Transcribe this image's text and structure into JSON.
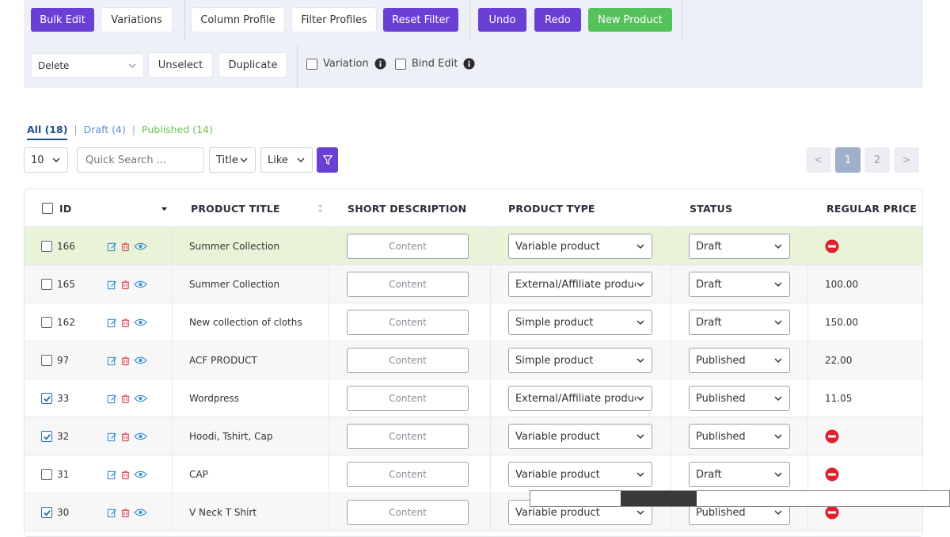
{
  "toolbar": {
    "bulk_edit": "Bulk Edit",
    "variations": "Variations",
    "column_profile": "Column Profile",
    "filter_profiles": "Filter Profiles",
    "reset_filter": "Reset Filter",
    "undo": "Undo",
    "redo": "Redo",
    "new_product": "New Product",
    "bulk_action": "Delete",
    "unselect": "Unselect",
    "duplicate": "Duplicate",
    "variation_label": "Variation",
    "bind_edit_label": "Bind Edit"
  },
  "tabs": {
    "all": "All (18)",
    "draft": "Draft (4)",
    "published": "Published (14)",
    "separator": "|"
  },
  "filters": {
    "per_page": "10",
    "search_placeholder": "Quick Search ...",
    "field": "Title",
    "operator": "Like"
  },
  "pagination": {
    "prev": "<",
    "pages": [
      "1",
      "2"
    ],
    "current": "1",
    "next": ">"
  },
  "table": {
    "columns": {
      "id": "ID",
      "product_title": "PRODUCT TITLE",
      "short_description": "SHORT DESCRIPTION",
      "product_type": "PRODUCT TYPE",
      "status": "STATUS",
      "regular_price": "REGULAR PRICE"
    },
    "content_label": "Content",
    "rows": [
      {
        "id": "166",
        "title": "Summer Collection",
        "type": "Variable product",
        "status": "Draft",
        "price": "",
        "checked": false,
        "price_missing": true
      },
      {
        "id": "165",
        "title": "Summer Collection",
        "type": "External/Affiliate product",
        "status": "Draft",
        "price": "100.00",
        "checked": false,
        "price_missing": false
      },
      {
        "id": "162",
        "title": "New collection of cloths",
        "type": "Simple product",
        "status": "Draft",
        "price": "150.00",
        "checked": false,
        "price_missing": false
      },
      {
        "id": "97",
        "title": "ACF PRODUCT",
        "type": "Simple product",
        "status": "Published",
        "price": "22.00",
        "checked": false,
        "price_missing": false
      },
      {
        "id": "33",
        "title": "Wordpress",
        "type": "External/Affiliate product",
        "status": "Published",
        "price": "11.05",
        "checked": true,
        "price_missing": false
      },
      {
        "id": "32",
        "title": "Hoodi, Tshirt, Cap",
        "type": "Variable product",
        "status": "Published",
        "price": "",
        "checked": true,
        "price_missing": true
      },
      {
        "id": "31",
        "title": "CAP",
        "type": "Variable product",
        "status": "Draft",
        "price": "",
        "checked": false,
        "price_missing": true
      },
      {
        "id": "30",
        "title": "V Neck T Shirt",
        "type": "Variable product",
        "status": "Published",
        "price": "",
        "checked": true,
        "price_missing": true
      }
    ]
  },
  "colors": {
    "accent": "#6a3fd6",
    "success": "#55c15a",
    "highlight_row": "#e9f3d8",
    "danger": "#e0202a"
  },
  "icons": {
    "edit": "edit-icon",
    "delete": "trash-icon",
    "view": "eye-icon",
    "no_price": "no-entry-icon",
    "filter": "funnel-icon",
    "info": "info-icon"
  }
}
